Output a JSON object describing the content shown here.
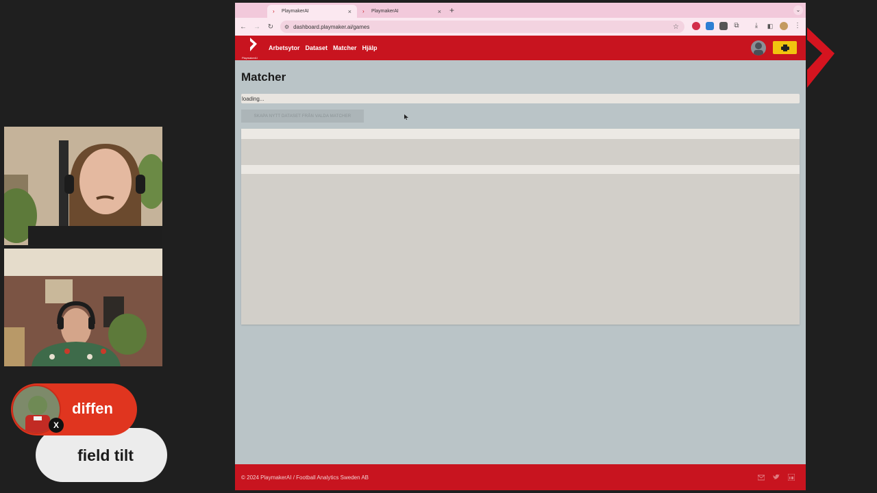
{
  "overlay": {
    "name": "diffen",
    "subtitle": "field tilt",
    "x_badge": "X"
  },
  "browser": {
    "tabs": [
      {
        "label": "PlaymakerAI",
        "close": "×"
      },
      {
        "label": "PlaymakerAI",
        "close": "×"
      }
    ],
    "new_tab": "+",
    "tab_menu": "⌄",
    "url": "dashboard.playmaker.ai/games",
    "back": "←",
    "forward": "→",
    "reload": "↻",
    "star": "☆"
  },
  "app": {
    "logo_text": "PlaymakerAI",
    "nav": [
      "Arbetsytor",
      "Dataset",
      "Matcher",
      "Hjälp"
    ],
    "page_title": "Matcher",
    "loading_text": "loading...",
    "create_button": "SKAPA NYTT DATASET FRÅN VALDA MATCHER",
    "footer": "© 2024 PlaymakerAI / Football Analytics Sweden AB"
  },
  "colors": {
    "brand_red": "#c8141f",
    "print_yellow": "#f1c40f",
    "badge_red": "#e0351f"
  }
}
